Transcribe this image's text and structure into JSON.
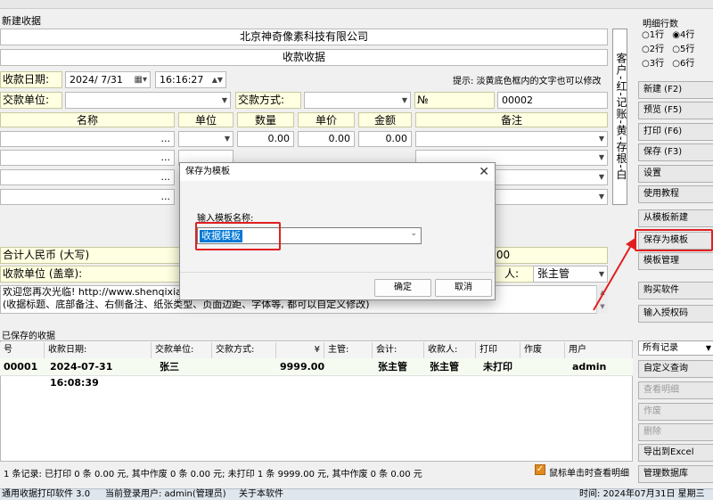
{
  "form": {
    "title": "新建收据",
    "company": "北京神奇像素科技有限公司",
    "doc_title": "收款收据",
    "date_label": "收款日期:",
    "date_value": "2024/ 7/31",
    "time_value": "16:16:27",
    "hint": "提示: 淡黄底色框内的文字也可以修改",
    "payer_label": "交款单位:",
    "pay_method_label": "交款方式:",
    "no_label": "№",
    "no_value": "00002",
    "columns": [
      "名称",
      "单位",
      "数量",
      "单价",
      "金额",
      "备注"
    ],
    "rows": [
      {
        "name": "...",
        "qty": "0.00",
        "price": "0.00",
        "amount": "0.00"
      },
      {
        "name": "...",
        "qty": "",
        "price": "",
        "amount": ""
      },
      {
        "name": "...",
        "qty": "",
        "price": "",
        "amount": ""
      },
      {
        "name": "...",
        "qty": "",
        "price": "",
        "amount": ""
      }
    ],
    "total_label": "合计人民币 (大写)",
    "total_value": ".00",
    "stamp_label": "收款单位 (盖章):",
    "payee_label": "人:",
    "payee_value": "张主管",
    "footer_line1": "欢迎您再次光临! http://www.shenqixia",
    "footer_line2": "(收据标题、底部备注、右侧备注、纸张类型、页面边距、字体等, 都可以自定义修改)",
    "vertical_text": "客户-红-记账-黄-存根-白"
  },
  "sidebar": {
    "rows_label": "明细行数",
    "radios": [
      "1行",
      "4行",
      "2行",
      "5行",
      "3行",
      "6行"
    ],
    "selected": "4行",
    "buttons": [
      {
        "label": "新建 (F2)",
        "disabled": false
      },
      {
        "label": "预览 (F5)",
        "disabled": false
      },
      {
        "label": "打印 (F6)",
        "disabled": false
      },
      {
        "label": "保存 (F3)",
        "disabled": false
      },
      {
        "label": "设置",
        "disabled": false
      },
      {
        "label": "使用教程",
        "disabled": false
      },
      {
        "label": "从模板新建",
        "disabled": false
      },
      {
        "label": "保存为模板",
        "disabled": false
      },
      {
        "label": "模板管理",
        "disabled": false
      },
      {
        "label": "购买软件",
        "disabled": false
      },
      {
        "label": "输入授权码",
        "disabled": false
      }
    ],
    "filter_value": "所有记录",
    "lower_buttons": [
      {
        "label": "自定义查询",
        "disabled": false
      },
      {
        "label": "查看明细",
        "disabled": true
      },
      {
        "label": "作废",
        "disabled": true
      },
      {
        "label": "删除",
        "disabled": true
      },
      {
        "label": "导出到Excel",
        "disabled": false
      },
      {
        "label": "管理数据库",
        "disabled": false
      }
    ]
  },
  "saved": {
    "title": "已保存的收据",
    "headers": [
      "号",
      "收款日期:",
      "交款单位:",
      "交款方式:",
      "¥",
      "主管:",
      "会计:",
      "收款人:",
      "打印",
      "作废",
      "用户"
    ],
    "row": [
      "00001",
      "2024-07-31 16:08:39",
      "张三",
      "",
      "9999.00",
      "",
      "张主管",
      "张主管",
      "未打印",
      "",
      "admin"
    ],
    "summary": "1 条记录:   已打印 0 条 0.00 元, 其中作废 0 条 0.00 元;   未打印 1 条 9999.00 元, 其中作废 0 条 0.00 元",
    "checkbox_label": "鼠标单击时查看明细"
  },
  "status": {
    "app": "通用收据打印软件 3.0",
    "user": "当前登录用户: admin(管理员)",
    "about": "关于本软件",
    "time": "时间: 2024年07月31日 星期三"
  },
  "dialog": {
    "title": "保存为模板",
    "field_label": "输入模板名称:",
    "field_value": "收据模板",
    "ok": "确定",
    "cancel": "取消"
  },
  "colors": {
    "highlight": "#e02020",
    "label_bg": "#ffffe1"
  }
}
